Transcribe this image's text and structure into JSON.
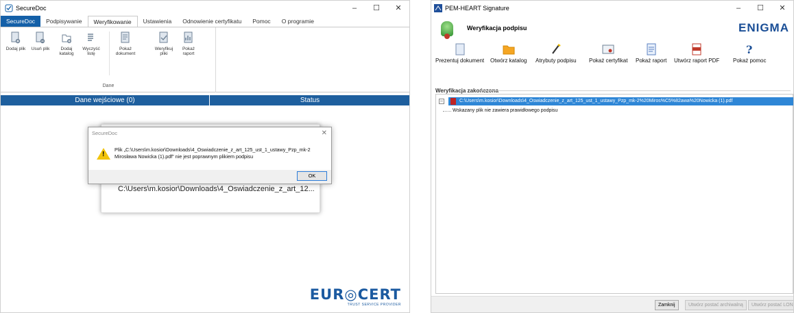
{
  "securedoc": {
    "title": "SecureDoc",
    "caption": {
      "minimize": "–",
      "maximize": "☐",
      "close": "✕"
    },
    "tabs": [
      "SecureDoc",
      "Podpisywanie",
      "Weryfikowanie",
      "Ustawienia",
      "Odnowienie certyfikatu",
      "Pomoc",
      "O programie"
    ],
    "ribbon": {
      "buttons": [
        {
          "label": "Dodaj plik",
          "icon": "add-file-icon"
        },
        {
          "label": "Usuń plik",
          "icon": "remove-file-icon"
        },
        {
          "label": "Dodaj katalog",
          "icon": "add-folder-icon"
        },
        {
          "label": "Wyczyść listę",
          "icon": "clear-list-icon"
        },
        {
          "label": "Pokaż dokument",
          "icon": "show-document-icon"
        },
        {
          "label": "Weryfikuj pliki",
          "icon": "verify-files-icon"
        },
        {
          "label": "Pokaż raport",
          "icon": "show-report-icon"
        }
      ],
      "group_label": "Dane"
    },
    "columns": {
      "input": "Dane wejściowe (0)",
      "status": "Status"
    },
    "background_dialog_path": "C:\\Users\\m.kosior\\Downloads\\4_Oswiadczenie_z_art_12...",
    "msgbox": {
      "title": "SecureDoc",
      "close": "✕",
      "text": "Plik „C:\\Users\\m.kosior\\Downloads\\4_Oswiadczenie_z_art_125_ust_1_ustawy_Pzp_mk-2 Mirosława Nowicka (1).pdf” nie jest poprawnym plikiem podpisu",
      "ok": "OK"
    },
    "logo": {
      "main": "EUR◎CERT",
      "sub": "TRUST SERVICE PROVIDER"
    }
  },
  "pemheart": {
    "title": "PEM-HEART Signature",
    "caption": {
      "minimize": "–",
      "maximize": "☐",
      "close": "✕"
    },
    "header_title": "Weryfikacja podpisu",
    "brand": "ENIGMA",
    "toolbar": [
      {
        "label": "Prezentuj dokument",
        "icon": "present-document-icon"
      },
      {
        "label": "Otwórz katalog",
        "icon": "open-folder-icon"
      },
      {
        "label": "Atrybuty podpisu",
        "icon": "signature-attributes-icon"
      },
      {
        "label": "Pokaż certyfikat",
        "icon": "show-certificate-icon"
      },
      {
        "label": "Pokaż raport",
        "icon": "show-report-icon"
      },
      {
        "label": "Utwórz raport PDF",
        "icon": "pdf-report-icon"
      },
      {
        "label": "Pokaż pomoc",
        "icon": "help-icon"
      }
    ],
    "section_label": "Weryfikacja zakończona",
    "tree": {
      "expander": "–",
      "file": "C:\\Users\\m.kosior\\Downloads\\4_Oswiadczenie_z_art_125_ust_1_ustawy_Pzp_mk-2%20Miros%C5%82awa%20Nowicka (1).pdf",
      "child": "Wskazany plik nie zawiera prawidłowego podpisu"
    },
    "buttons": {
      "close": "Zamknij",
      "archive": "Utwórz postać archiwalną",
      "long": "Utwórz postać LONG"
    }
  },
  "colors": {
    "accent": "#1460a8",
    "header_blue": "#1e5f9e",
    "selection": "#2e86d6",
    "warning": "#f2c40c",
    "enigma": "#1a4e96"
  }
}
